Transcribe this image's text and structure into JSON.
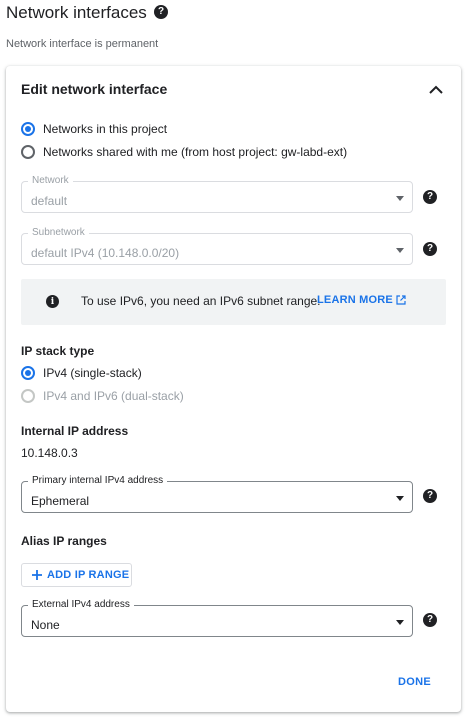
{
  "header": {
    "title": "Network interfaces",
    "help_icon": "help-circle-icon",
    "subtitle": "Network interface is permanent"
  },
  "card": {
    "title": "Edit network interface",
    "collapse_icon": "chevron-up-icon"
  },
  "network_scope": {
    "options": [
      {
        "label": "Networks in this project",
        "selected": true
      },
      {
        "label": "Networks shared with me (from host project: gw-labd-ext)",
        "selected": false
      }
    ]
  },
  "network_field": {
    "label": "Network",
    "value": "default",
    "disabled": true
  },
  "subnetwork_field": {
    "label": "Subnetwork",
    "value": "default IPv4 (10.148.0.0/20)",
    "disabled": true
  },
  "ipv6_info": {
    "icon": "info-icon",
    "text": "To use IPv6, you need an IPv6 subnet range.",
    "link_label": "LEARN MORE",
    "link_icon": "external-link-icon"
  },
  "ip_stack": {
    "label": "IP stack type",
    "options": [
      {
        "label": "IPv4 (single-stack)",
        "selected": true,
        "disabled": false
      },
      {
        "label": "IPv4 and IPv6 (dual-stack)",
        "selected": false,
        "disabled": true
      }
    ]
  },
  "internal_ip": {
    "label": "Internal IP address",
    "value": "10.148.0.3",
    "primary_field": {
      "label": "Primary internal IPv4 address",
      "value": "Ephemeral"
    }
  },
  "alias_ip": {
    "label": "Alias IP ranges",
    "add_button": "ADD IP RANGE",
    "add_icon": "plus-icon"
  },
  "external_ip": {
    "label": "External IPv4 address",
    "value": "None"
  },
  "actions": {
    "done_label": "DONE"
  },
  "colors": {
    "accent": "#1a73e8",
    "text": "#202124",
    "muted": "#9aa0a6",
    "infobox_bg": "#f1f3f4"
  }
}
